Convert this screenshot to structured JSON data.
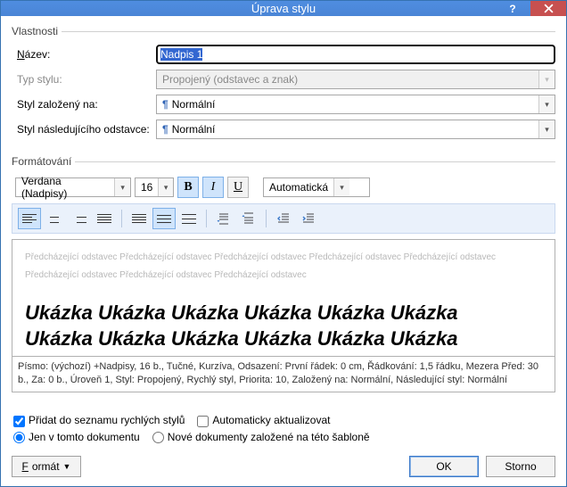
{
  "window": {
    "title": "Úprava stylu"
  },
  "sections": {
    "properties": "Vlastnosti",
    "formatting": "Formátování"
  },
  "labels": {
    "name": "Název:",
    "style_type": "Typ stylu:",
    "based_on": "Styl založený na:",
    "following": "Styl následujícího odstavce:"
  },
  "values": {
    "name": "Nadpis 1",
    "style_type": "Propojený (odstavec a znak)",
    "based_on": "Normální",
    "following": "Normální"
  },
  "toolbar": {
    "font": "Verdana (Nadpisy)",
    "size": "16",
    "bold": "B",
    "italic": "I",
    "underline": "U",
    "color": "Automatická"
  },
  "preview": {
    "gray_text": "Předcházející odstavec Předcházející odstavec Předcházející odstavec Předcházející odstavec Předcházející odstavec Předcházející odstavec Předcházející odstavec Předcházející odstavec",
    "sample_line": "Ukázka Ukázka Ukázka Ukázka Ukázka Ukázka"
  },
  "description": "Písmo: (výchozí) +Nadpisy, 16 b., Tučné, Kurzíva, Odsazení: První řádek:  0 cm, Řádkování:  1,5 řádku, Mezera Před:  30 b., Za:  0 b., Úroveň 1, Styl: Propojený, Rychlý styl, Priorita: 10, Založený na: Normální, Následující styl: Normální",
  "options": {
    "quick_styles": "Přidat do seznamu rychlých stylů",
    "auto_update": "Automaticky aktualizovat",
    "this_doc": "Jen v tomto dokumentu",
    "new_docs": "Nové dokumenty založené na této šabloně"
  },
  "buttons": {
    "format": "Formát",
    "ok": "OK",
    "cancel": "Storno"
  }
}
